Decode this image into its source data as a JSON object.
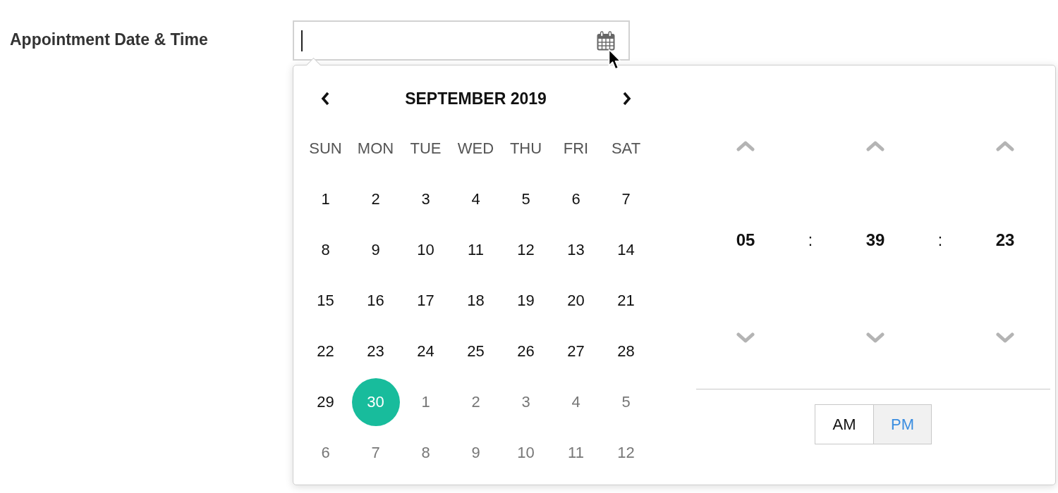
{
  "form_row": {
    "label": "Appointment Date & Time",
    "input": {
      "focused": true
    }
  },
  "calendar": {
    "title": "SEPTEMBER 2019",
    "weekdays": [
      "SUN",
      "MON",
      "TUE",
      "WED",
      "THU",
      "FRI",
      "SAT"
    ],
    "weeks": [
      [
        {
          "label": "1",
          "outside": false,
          "selected": false
        },
        {
          "label": "2",
          "outside": false,
          "selected": false
        },
        {
          "label": "3",
          "outside": false,
          "selected": false
        },
        {
          "label": "4",
          "outside": false,
          "selected": false
        },
        {
          "label": "5",
          "outside": false,
          "selected": false
        },
        {
          "label": "6",
          "outside": false,
          "selected": false
        },
        {
          "label": "7",
          "outside": false,
          "selected": false
        }
      ],
      [
        {
          "label": "8",
          "outside": false,
          "selected": false
        },
        {
          "label": "9",
          "outside": false,
          "selected": false
        },
        {
          "label": "10",
          "outside": false,
          "selected": false
        },
        {
          "label": "11",
          "outside": false,
          "selected": false
        },
        {
          "label": "12",
          "outside": false,
          "selected": false
        },
        {
          "label": "13",
          "outside": false,
          "selected": false
        },
        {
          "label": "14",
          "outside": false,
          "selected": false
        }
      ],
      [
        {
          "label": "15",
          "outside": false,
          "selected": false
        },
        {
          "label": "16",
          "outside": false,
          "selected": false
        },
        {
          "label": "17",
          "outside": false,
          "selected": false
        },
        {
          "label": "18",
          "outside": false,
          "selected": false
        },
        {
          "label": "19",
          "outside": false,
          "selected": false
        },
        {
          "label": "20",
          "outside": false,
          "selected": false
        },
        {
          "label": "21",
          "outside": false,
          "selected": false
        }
      ],
      [
        {
          "label": "22",
          "outside": false,
          "selected": false
        },
        {
          "label": "23",
          "outside": false,
          "selected": false
        },
        {
          "label": "24",
          "outside": false,
          "selected": false
        },
        {
          "label": "25",
          "outside": false,
          "selected": false
        },
        {
          "label": "26",
          "outside": false,
          "selected": false
        },
        {
          "label": "27",
          "outside": false,
          "selected": false
        },
        {
          "label": "28",
          "outside": false,
          "selected": false
        }
      ],
      [
        {
          "label": "29",
          "outside": false,
          "selected": false
        },
        {
          "label": "30",
          "outside": false,
          "selected": true
        },
        {
          "label": "1",
          "outside": true,
          "selected": false
        },
        {
          "label": "2",
          "outside": true,
          "selected": false
        },
        {
          "label": "3",
          "outside": true,
          "selected": false
        },
        {
          "label": "4",
          "outside": true,
          "selected": false
        },
        {
          "label": "5",
          "outside": true,
          "selected": false
        }
      ],
      [
        {
          "label": "6",
          "outside": true,
          "selected": false
        },
        {
          "label": "7",
          "outside": true,
          "selected": false
        },
        {
          "label": "8",
          "outside": true,
          "selected": false
        },
        {
          "label": "9",
          "outside": true,
          "selected": false
        },
        {
          "label": "10",
          "outside": true,
          "selected": false
        },
        {
          "label": "11",
          "outside": true,
          "selected": false
        },
        {
          "label": "12",
          "outside": true,
          "selected": false
        }
      ]
    ]
  },
  "time": {
    "units": [
      {
        "value": "05"
      },
      {
        "value": "39"
      },
      {
        "value": "23"
      }
    ],
    "separators": [
      ":",
      ":"
    ],
    "meridiem": [
      {
        "label": "AM",
        "selected": false
      },
      {
        "label": "PM",
        "selected": true
      }
    ]
  }
}
